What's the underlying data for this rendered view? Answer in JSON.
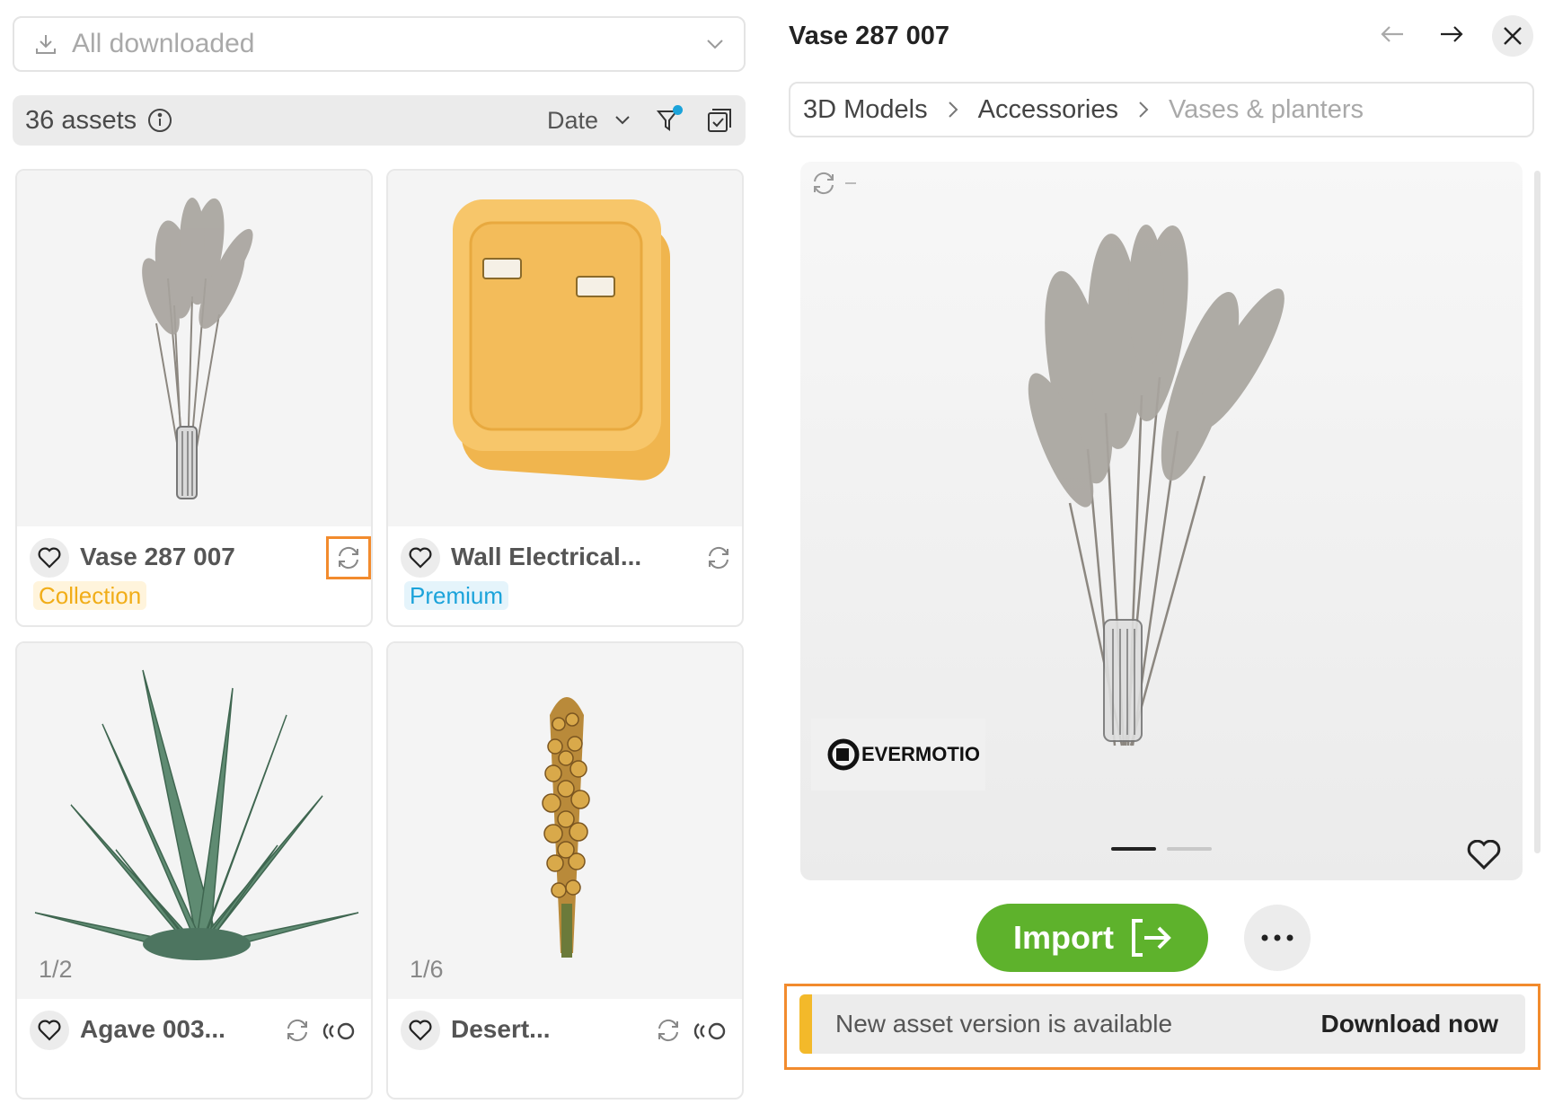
{
  "filter": {
    "label": "All downloaded"
  },
  "toolbar": {
    "asset_count": "36 assets",
    "sort_label": "Date"
  },
  "cards": [
    {
      "name": "Vase 287 007",
      "badge": "Collection"
    },
    {
      "name": "Wall Electrical...",
      "badge": "Premium"
    },
    {
      "name": "Agave 003...",
      "pager": "1/2"
    },
    {
      "name": "Desert...",
      "pager": "1/6"
    }
  ],
  "detail": {
    "title": "Vase 287 007",
    "breadcrumb": [
      "3D Models",
      "Accessories",
      "Vases & planters"
    ],
    "watermark_logo": "EVERMOTION",
    "import_label": "Import",
    "notice": {
      "message": "New asset version is available",
      "action": "Download now"
    }
  },
  "colors": {
    "import_green": "#5eb22c",
    "highlight_orange": "#f28b2d",
    "collection_badge": "#f1ad18",
    "premium_badge": "#1ba3da",
    "notice_accent": "#f3b92a",
    "filter_dot": "#1ba3da"
  },
  "icons": {
    "filter_dropdown": "download-icon",
    "info": "info-icon",
    "filter": "filter-icon",
    "select": "select-all-icon",
    "update": "refresh-icon",
    "ar": "ar-icon",
    "favorite": "heart-icon",
    "nav_prev": "arrow-left-icon",
    "nav_next": "arrow-right-icon",
    "close": "close-icon",
    "more": "more-icon"
  }
}
